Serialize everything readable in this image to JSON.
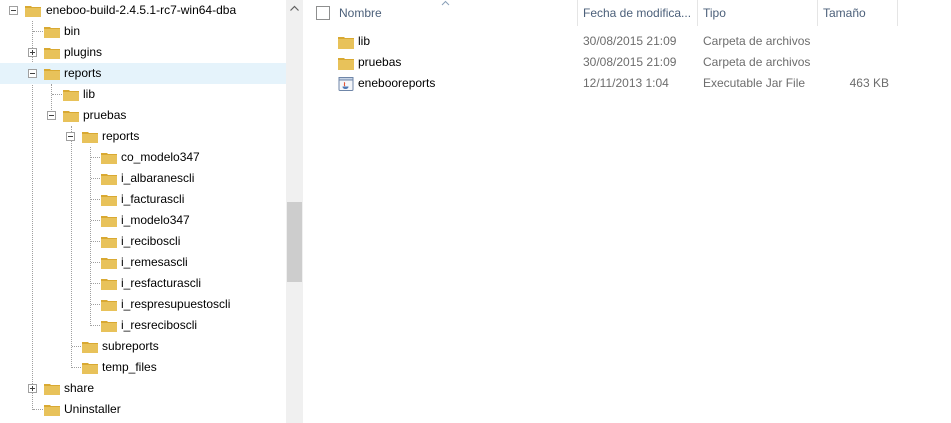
{
  "tree": {
    "root": {
      "label": "eneboo-build-2.4.5.1-rc7-win64-dba"
    },
    "items": [
      {
        "label": "bin"
      },
      {
        "label": "plugins"
      },
      {
        "label": "reports"
      },
      {
        "label": "lib"
      },
      {
        "label": "pruebas"
      },
      {
        "label": "reports"
      },
      {
        "label": "co_modelo347"
      },
      {
        "label": "i_albaranescli"
      },
      {
        "label": "i_facturascli"
      },
      {
        "label": "i_modelo347"
      },
      {
        "label": "i_reciboscli"
      },
      {
        "label": "i_remesascli"
      },
      {
        "label": "i_resfacturascli"
      },
      {
        "label": "i_respresupuestoscli"
      },
      {
        "label": "i_resreciboscli"
      },
      {
        "label": "subreports"
      },
      {
        "label": "temp_files"
      },
      {
        "label": "share"
      },
      {
        "label": "Uninstaller"
      }
    ]
  },
  "columns": {
    "name": "Nombre",
    "date": "Fecha de modifica...",
    "type": "Tipo",
    "size": "Tamaño"
  },
  "files": [
    {
      "name": "lib",
      "date": "30/08/2015 21:09",
      "type": "Carpeta de archivos",
      "size": "",
      "icon": "folder-icon"
    },
    {
      "name": "pruebas",
      "date": "30/08/2015 21:09",
      "type": "Carpeta de archivos",
      "size": "",
      "icon": "folder-icon"
    },
    {
      "name": "enebooreports",
      "date": "12/11/2013 1:04",
      "type": "Executable Jar File",
      "size": "463 KB",
      "icon": "jar-file-icon"
    }
  ],
  "colors": {
    "folder_body": "#e8c25a",
    "folder_tab": "#d9a932",
    "header_text": "#4c607a",
    "selection": "#e5f3fb"
  }
}
